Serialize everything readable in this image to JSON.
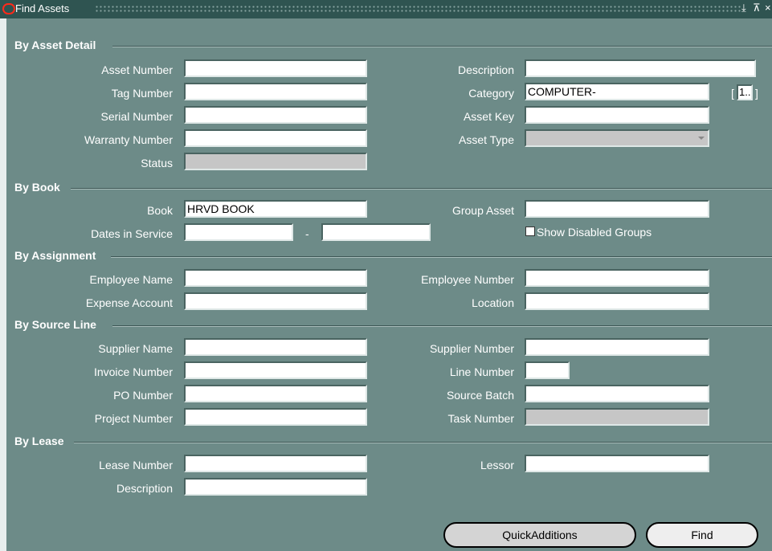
{
  "window": {
    "title": "Find Assets",
    "controls": [
      "⤓",
      "⊼",
      "×"
    ]
  },
  "sections": {
    "asset_detail": "By Asset Detail",
    "book": "By Book",
    "assignment": "By Assignment",
    "source_line": "By Source Line",
    "lease": "By Lease"
  },
  "asset_detail": {
    "asset_number_label": "Asset Number",
    "asset_number_value": "",
    "tag_number_label": "Tag Number",
    "tag_number_value": "",
    "serial_number_label": "Serial Number",
    "serial_number_value": "",
    "warranty_number_label": "Warranty Number",
    "warranty_number_value": "",
    "status_label": "Status",
    "status_value": "",
    "description_label": "Description",
    "description_value": "",
    "category_label": "Category",
    "category_value": "COMPUTER-",
    "category_flex": "1..",
    "asset_key_label": "Asset Key",
    "asset_key_value": "",
    "asset_type_label": "Asset Type",
    "asset_type_value": ""
  },
  "book": {
    "book_label": "Book",
    "book_value": "HRVD BOOK",
    "dates_label": "Dates in Service",
    "date_from": "",
    "date_sep": "-",
    "date_to": "",
    "group_asset_label": "Group Asset",
    "group_asset_value": "",
    "show_disabled_label": "Show Disabled Groups",
    "show_disabled_checked": false
  },
  "assignment": {
    "employee_name_label": "Employee Name",
    "employee_name_value": "",
    "expense_account_label": "Expense Account",
    "expense_account_value": "",
    "employee_number_label": "Employee Number",
    "employee_number_value": "",
    "location_label": "Location",
    "location_value": ""
  },
  "source_line": {
    "supplier_name_label": "Supplier Name",
    "supplier_name_value": "",
    "invoice_number_label": "Invoice Number",
    "invoice_number_value": "",
    "po_number_label": "PO Number",
    "po_number_value": "",
    "project_number_label": "Project Number",
    "project_number_value": "",
    "supplier_number_label": "Supplier Number",
    "supplier_number_value": "",
    "line_number_label": "Line Number",
    "line_number_value": "",
    "source_batch_label": "Source Batch",
    "source_batch_value": "",
    "task_number_label": "Task Number",
    "task_number_value": ""
  },
  "lease": {
    "lease_number_label": "Lease Number",
    "lease_number_value": "",
    "description_label": "Description",
    "description_value": "",
    "lessor_label": "Lessor",
    "lessor_value": ""
  },
  "buttons": {
    "quick_additions": "QuickAdditions",
    "find": "Find"
  },
  "colors": {
    "background": "#6d8b88",
    "titlebar": "#2f5451",
    "field": "#ffffff",
    "disabled_field": "#c6c6c6",
    "logo": "#ff2a1a"
  }
}
